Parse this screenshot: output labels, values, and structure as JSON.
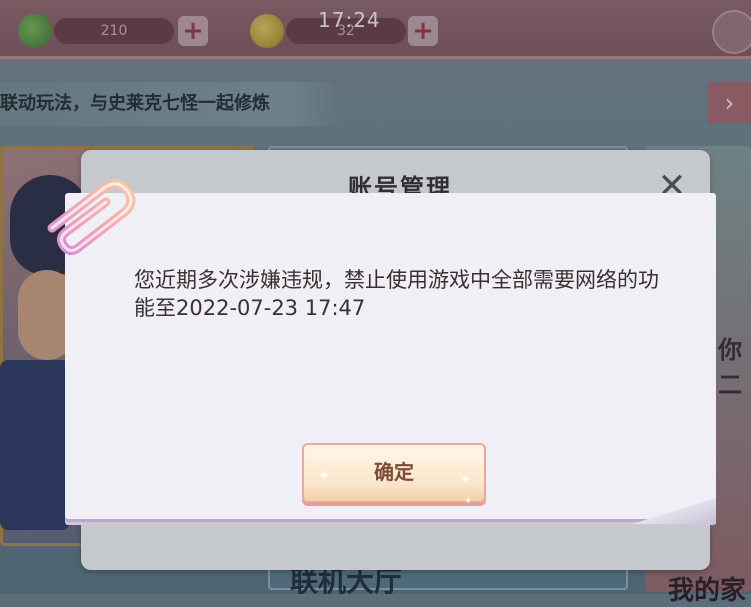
{
  "status": {
    "time": "17:24"
  },
  "resources": [
    {
      "name": "green-gem",
      "value": "210",
      "color": "#4f8f3a"
    },
    {
      "name": "gold-coin",
      "value": "32",
      "color": "#c9a030"
    }
  ],
  "ticker": {
    "text": "联动玩法，与史莱克七怪一起修炼"
  },
  "background": {
    "lobby_label": "联机大厅",
    "mine_label": "我的家",
    "side_label": "你二"
  },
  "dialog": {
    "title": "账号管理",
    "message": "您近期多次涉嫌违规，禁止使用游戏中全部需要网络的功能至2022-07-23 17:47",
    "ok_label": "确定"
  },
  "colors": {
    "accent": "#e99b96",
    "dialog_paper": "#efeff5",
    "topbar": "#8a5a62"
  }
}
